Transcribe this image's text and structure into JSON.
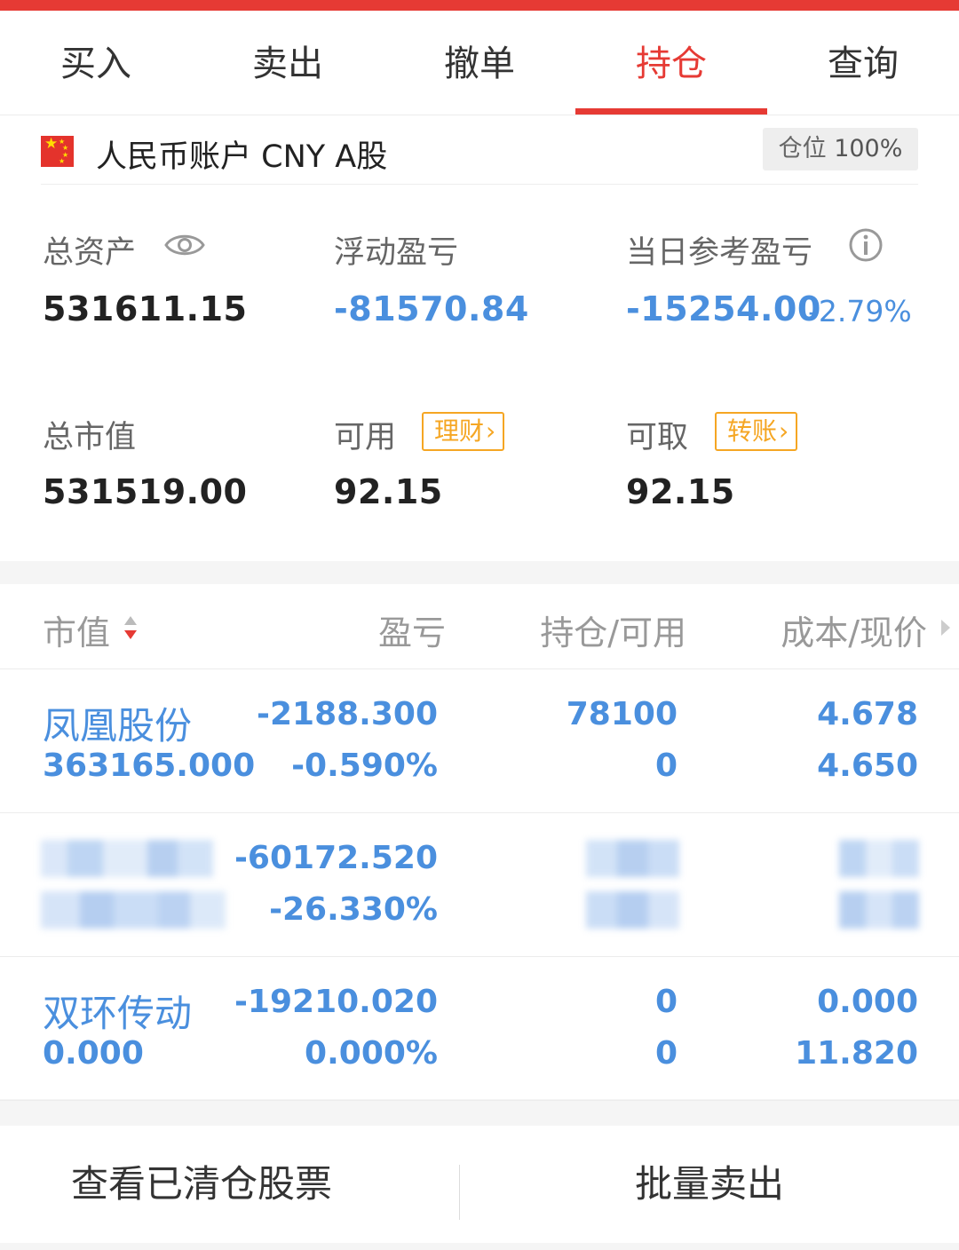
{
  "tabs": [
    {
      "label": "买入"
    },
    {
      "label": "卖出"
    },
    {
      "label": "撤单"
    },
    {
      "label": "持仓",
      "active": true
    },
    {
      "label": "查询"
    }
  ],
  "account": {
    "title": "人民币账户 CNY A股",
    "position_label": "仓位",
    "position_value": "100%",
    "total_assets_label": "总资产",
    "total_assets": "531611.15",
    "floating_pl_label": "浮动盈亏",
    "floating_pl": "-81570.84",
    "daily_pl_label": "当日参考盈亏",
    "daily_pl": "-15254.00",
    "daily_pl_pct": "-2.79%",
    "market_value_label": "总市值",
    "market_value": "531519.00",
    "available_label": "可用",
    "available": "92.15",
    "wealth_btn": "理财",
    "withdrawable_label": "可取",
    "withdrawable": "92.15",
    "transfer_btn": "转账"
  },
  "table": {
    "headers": [
      "市值",
      "盈亏",
      "持仓/可用",
      "成本/现价"
    ],
    "rows": [
      {
        "name": "凤凰股份",
        "market_value": "363165.000",
        "pl": "-2188.300",
        "pl_pct": "-0.590%",
        "position": "78100",
        "available": "0",
        "cost": "4.678",
        "price": "4.650"
      },
      {
        "name": "",
        "market_value": "",
        "pl": "-60172.520",
        "pl_pct": "-26.330%",
        "position": "",
        "available": "",
        "cost": "",
        "price": ""
      },
      {
        "name": "双环传动",
        "market_value": "0.000",
        "pl": "-19210.020",
        "pl_pct": "0.000%",
        "position": "0",
        "available": "0",
        "cost": "0.000",
        "price": "11.820"
      }
    ]
  },
  "bottom": {
    "cleared_btn": "查看已清仓股票",
    "batch_sell_btn": "批量卖出"
  },
  "colors": {
    "accent": "#e63a34",
    "loss": "#4a8fde",
    "tag": "#f5a623"
  }
}
